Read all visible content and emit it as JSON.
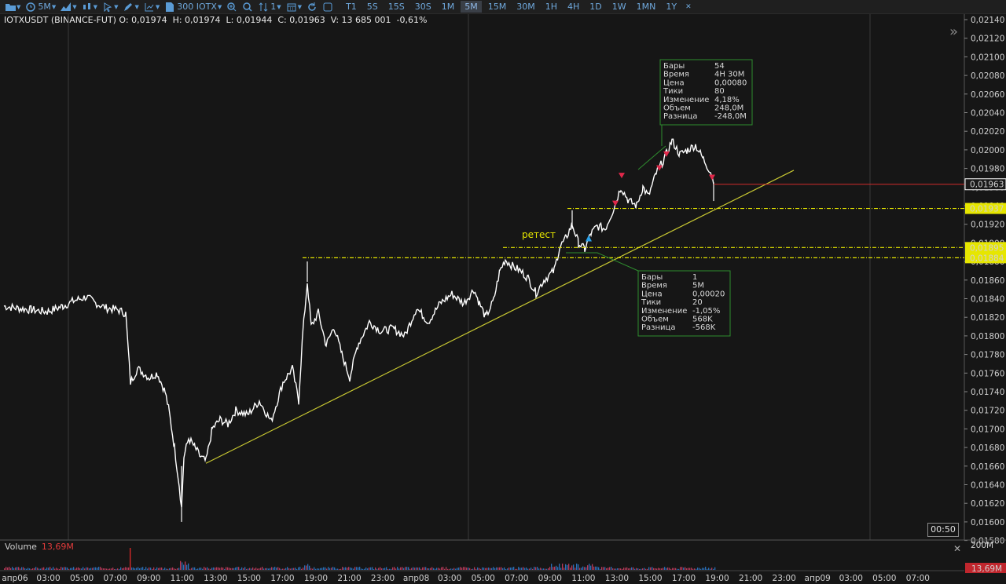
{
  "toolbar": {
    "interval_label": "5M",
    "quantity_label": "300 IOTX",
    "order_count_label": "1",
    "timeframes": [
      "T1",
      "5S",
      "15S",
      "30S",
      "1M",
      "5M",
      "15M",
      "30M",
      "1H",
      "4H",
      "1D",
      "1W",
      "1MN",
      "1Y"
    ],
    "active_timeframe": "5M",
    "close_glyph": "✕"
  },
  "info_line": "IOTXUSDT (BINANCE-FUT) O: 0,01974  H: 0,01974  L: 0,01944  C: 0,01963  V: 13 685 001  -0,61%",
  "price_axis": [
    "0,02140",
    "0,02120",
    "0,02100",
    "0,02080",
    "0,02060",
    "0,02040",
    "0,02020",
    "0,02000",
    "0,01980",
    "0,01960",
    "0,01940",
    "0,01920",
    "0,01900",
    "0,01880",
    "0,01860",
    "0,01840",
    "0,01820",
    "0,01800",
    "0,01780",
    "0,01760",
    "0,01740",
    "0,01720",
    "0,01700",
    "0,01680",
    "0,01660",
    "0,01640",
    "0,01620",
    "0,01600",
    "0,01580"
  ],
  "time_axis": [
    "апр06",
    "03:00",
    "05:00",
    "07:00",
    "09:00",
    "11:00",
    "13:00",
    "15:00",
    "17:00",
    "19:00",
    "21:00",
    "23:00",
    "апр08",
    "03:00",
    "05:00",
    "07:00",
    "09:00",
    "11:00",
    "13:00",
    "15:00",
    "17:00",
    "19:00",
    "21:00",
    "23:00",
    "апр09",
    "03:00",
    "05:00",
    "07:00"
  ],
  "price_tags": {
    "current": "0,01963",
    "level1": "0,01937",
    "level2": "0,01895",
    "level3": "0,01884"
  },
  "annotation_text": "ретест",
  "measure_upper": {
    "rows": [
      [
        "Бары",
        "54"
      ],
      [
        "Время",
        "4H 30M"
      ],
      [
        "Цена",
        "0,00080"
      ],
      [
        "Тики",
        "80"
      ],
      [
        "Изменение",
        "4,18%"
      ],
      [
        "Объем",
        "248,0M"
      ],
      [
        "Разница",
        "-248,0M"
      ]
    ]
  },
  "measure_lower": {
    "rows": [
      [
        "Бары",
        "1"
      ],
      [
        "Время",
        "5M"
      ],
      [
        "Цена",
        "0,00020"
      ],
      [
        "Тики",
        "20"
      ],
      [
        "Изменение",
        "-1,05%"
      ],
      [
        "Объем",
        "568K"
      ],
      [
        "Разница",
        "-568K"
      ]
    ]
  },
  "timer": "00:50",
  "volume": {
    "title": "Volume",
    "value": "13,69M",
    "axis_top": "200M",
    "axis_tag": "13,69M"
  },
  "colors": {
    "background": "#161616",
    "price_line": "#ffffff",
    "level": "#e6e600",
    "trendline": "#c8c832",
    "current_line": "#d22b2b",
    "measure_box": "#2f8f2f",
    "sell_marker": "#e0284a",
    "buy_marker": "#2aa0e8"
  },
  "icons": [
    "folder-icon",
    "clock-icon",
    "chart-type-icon",
    "candles-icon",
    "cursor-icon",
    "draw-icon",
    "indicators-icon",
    "document-icon",
    "zoom-in-icon",
    "search-icon",
    "sort-icon",
    "calendar-icon",
    "refresh-icon",
    "panel-icon",
    "expand-icon",
    "close-icon"
  ]
}
